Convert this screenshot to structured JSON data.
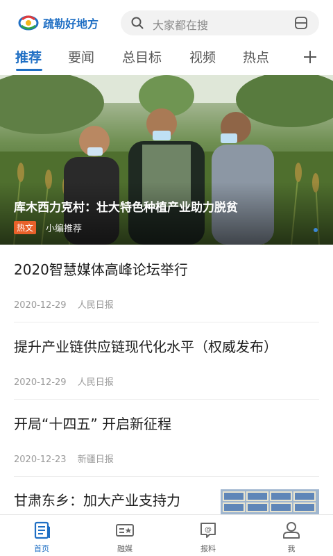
{
  "header": {
    "app_name": "疏勒好地方",
    "search_placeholder": "大家都在搜"
  },
  "tabs": [
    {
      "label": "推荐",
      "active": true
    },
    {
      "label": "要闻",
      "active": false
    },
    {
      "label": "总目标",
      "active": false
    },
    {
      "label": "视频",
      "active": false
    },
    {
      "label": "热点",
      "active": false
    }
  ],
  "hero": {
    "title": "库木西力克村：壮大特色种植产业助力脱贫",
    "badge": "热文",
    "source": "小编推荐"
  },
  "news": [
    {
      "title": "2020智慧媒体高峰论坛举行",
      "date": "2020-12-29",
      "source": "人民日报"
    },
    {
      "title": "提升产业链供应链现代化水平（权威发布）",
      "date": "2020-12-29",
      "source": "人民日报"
    },
    {
      "title": "开局“十四五” 开启新征程",
      "date": "2020-12-23",
      "source": "新疆日报"
    }
  ],
  "partial_news": {
    "title": "甘肃东乡：加大产业支持力"
  },
  "bottom_nav": [
    {
      "label": "首页",
      "icon": "home-doc-icon",
      "active": true
    },
    {
      "label": "融媒",
      "icon": "media-card-icon",
      "active": false
    },
    {
      "label": "报料",
      "icon": "report-at-icon",
      "active": false
    },
    {
      "label": "我",
      "icon": "user-icon",
      "active": false
    }
  ],
  "colors": {
    "brand": "#1f6fc4",
    "badge": "#e8612a"
  }
}
